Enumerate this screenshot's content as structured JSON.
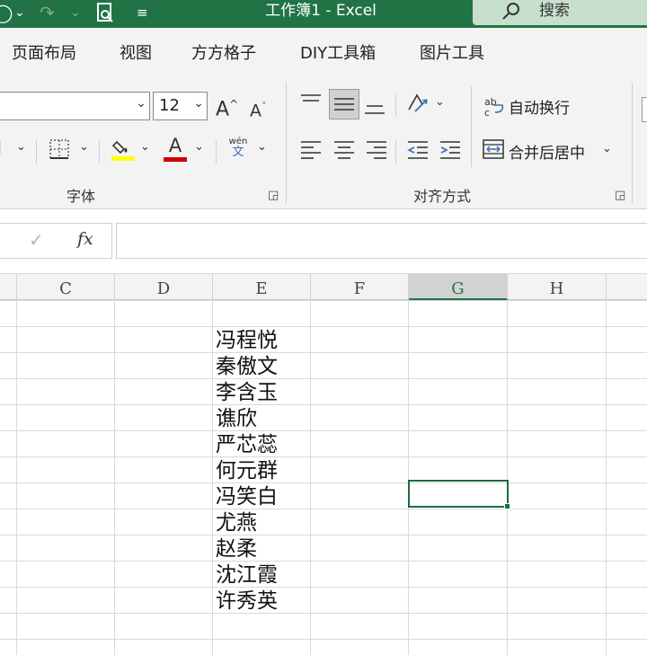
{
  "app": {
    "title": "工作簿1  -  Excel",
    "accent_color": "#217346",
    "quick_access": [
      "autosave-icon",
      "redo-icon",
      "chevron-down-icon",
      "print-preview-icon",
      "customize-qat-icon"
    ]
  },
  "search": {
    "label": "搜索",
    "icon": "search-icon"
  },
  "tabs": [
    {
      "label": "页面布局"
    },
    {
      "label": "视图"
    },
    {
      "label": "方方格子"
    },
    {
      "label": "DIY工具箱"
    },
    {
      "label": "图片工具"
    }
  ],
  "font_group": {
    "label": "字体",
    "font_name": "",
    "font_size": "12",
    "grow_font": "A",
    "shrink_font": "A",
    "font_color_glyph": "A",
    "phonetic_top": "wén",
    "phonetic_bottom": "文",
    "fill_color": "#ffff00",
    "font_color": "#d00000"
  },
  "alignment_group": {
    "label": "对齐方式",
    "wrap_text": "自动换行",
    "merge_center": "合并后居中"
  },
  "formula_bar": {
    "fx": "fx",
    "value": ""
  },
  "columns": [
    {
      "label": "C"
    },
    {
      "label": "D"
    },
    {
      "label": "E"
    },
    {
      "label": "F"
    },
    {
      "label": "G"
    },
    {
      "label": "H"
    }
  ],
  "selected_column": "G",
  "column_e_values": [
    "冯程悦",
    "秦傲文",
    "李含玉",
    "谯欣",
    "严芯蕊",
    "何元群",
    "冯笑白",
    "尤燕",
    "赵柔",
    "沈江霞",
    "许秀英"
  ]
}
